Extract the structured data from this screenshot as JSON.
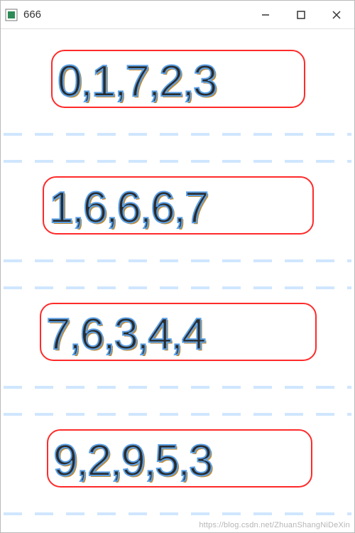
{
  "window": {
    "title": "666"
  },
  "rows": {
    "0": "0,1,7,2,3",
    "1": "1,6,6,6,7",
    "2": "7,6,3,4,4",
    "3": "9,2,9,5,3"
  },
  "watermark": "https://blog.csdn.net/ZhuanShangNiDeXin"
}
